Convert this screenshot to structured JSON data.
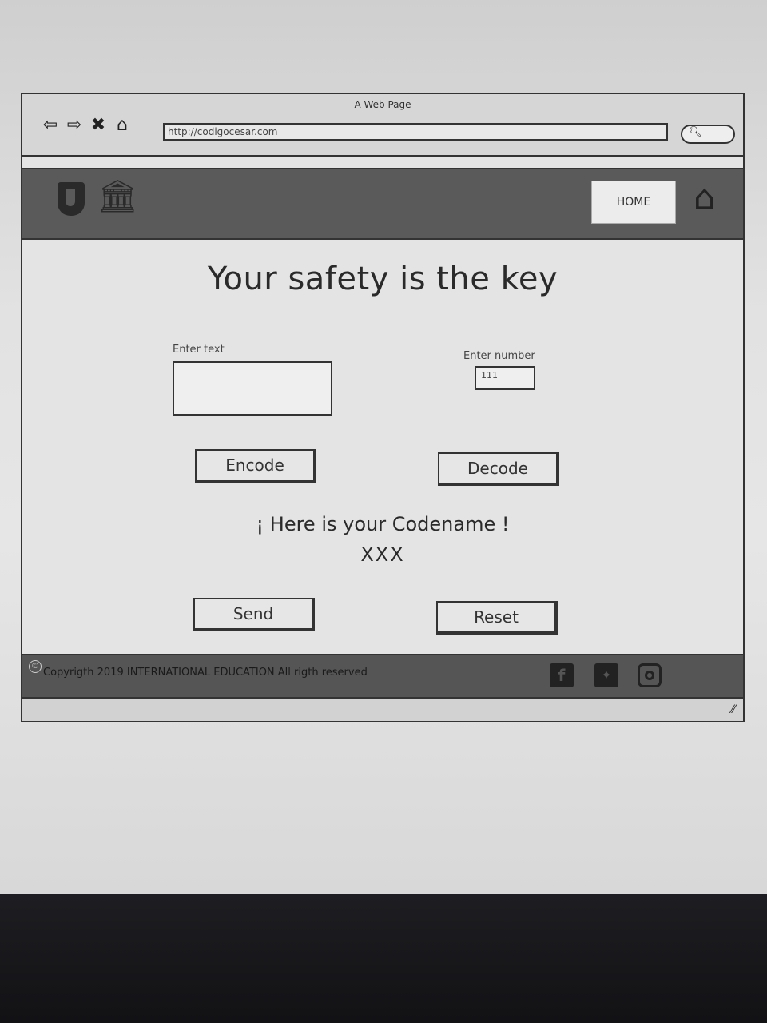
{
  "browser": {
    "window_title": "A Web Page",
    "url": "http://codigocesar.com",
    "nav_icons": [
      "arrow-left-icon",
      "arrow-right-icon",
      "close-icon",
      "home-outline-icon"
    ]
  },
  "header": {
    "home_label": "HOME",
    "icons": [
      "shield-icon",
      "bank-icon",
      "house-icon"
    ]
  },
  "main": {
    "title": "Your safety is the key",
    "text_label": "Enter text",
    "text_value": "",
    "number_label": "Enter number",
    "number_value": "111",
    "encode_label": "Encode",
    "decode_label": "Decode",
    "codename_label": "¡ Here is your Codename !",
    "codename_value": "XXX",
    "send_label": "Send",
    "reset_label": "Reset"
  },
  "footer": {
    "copyright": "Copyrigth 2019 INTERNATIONAL EDUCATION All rigth reserved",
    "social_icons": [
      "facebook-icon",
      "twitter-icon",
      "instagram-icon"
    ]
  }
}
